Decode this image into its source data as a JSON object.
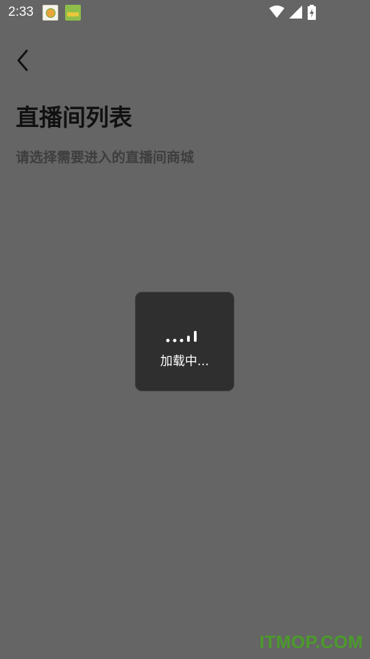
{
  "status_bar": {
    "time": "2:33",
    "icons": [
      "app-notification-icon",
      "app-notification-icon",
      "wifi-icon",
      "cellular-signal-icon",
      "battery-charging-icon"
    ]
  },
  "header": {
    "back_icon": "chevron-left-icon"
  },
  "main": {
    "title": "直播间列表",
    "subtitle": "请选择需要进入的直播间商城"
  },
  "loading": {
    "text": "加载中...",
    "icon": "loading-dots-icon"
  },
  "watermark": {
    "text": "ITMOP.COM"
  },
  "colors": {
    "background": "#656565",
    "toast": "#2f2f2f",
    "title": "#111111",
    "subtitle": "#3e3e3e",
    "watermark": "#4b9b2a"
  }
}
